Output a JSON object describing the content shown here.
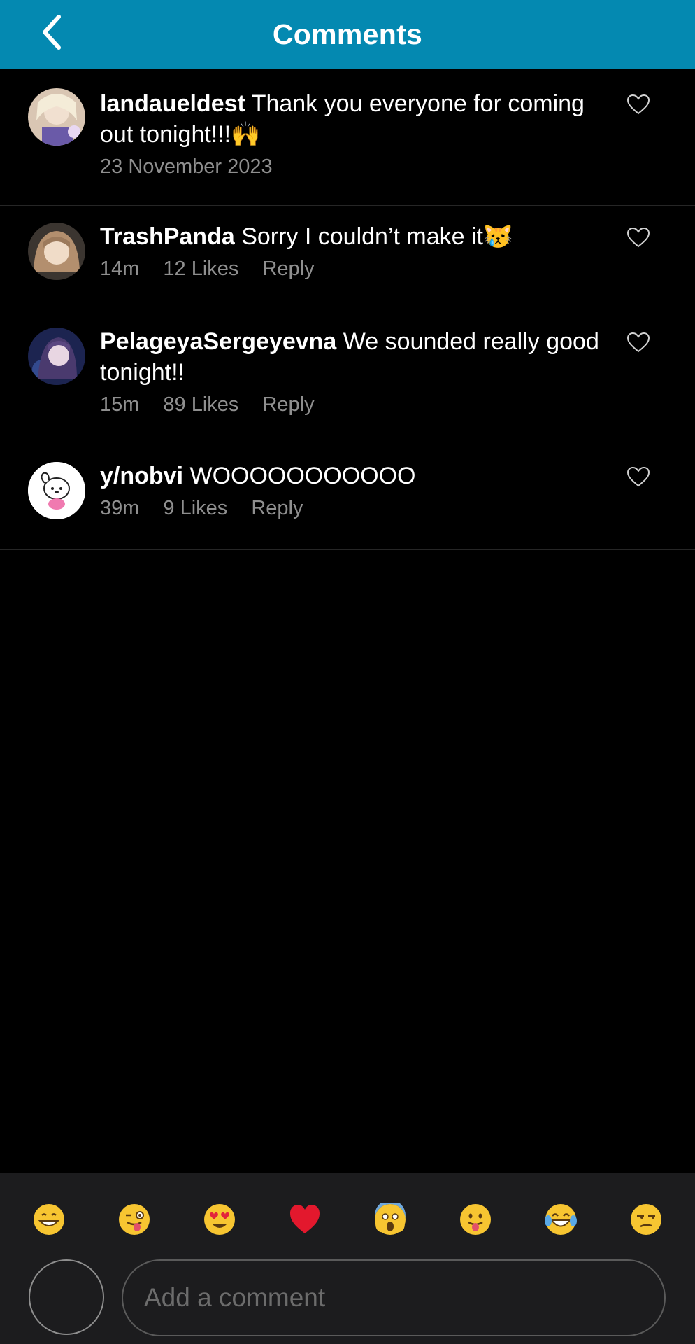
{
  "header": {
    "title": "Comments"
  },
  "comments": [
    {
      "username": "landaueldest",
      "text": "Thank you everyone for coming out tonight!!!🙌",
      "date": "23 November 2023"
    },
    {
      "username": "TrashPanda",
      "text": "Sorry I couldn’t make it😿",
      "time": "14m",
      "likes": "12 Likes",
      "reply": "Reply"
    },
    {
      "username": "PelageyaSergeyevna",
      "text": "We sounded really good tonight!!",
      "time": "15m",
      "likes": "89 Likes",
      "reply": "Reply"
    },
    {
      "username": "y/nobvi",
      "text": "WOOOOOOOOOOO",
      "time": "39m",
      "likes": "9 Likes",
      "reply": "Reply"
    }
  ],
  "emoji_bar": [
    "grin-icon",
    "wink-tongue-icon",
    "heart-eyes-icon",
    "red-heart-icon",
    "scream-icon",
    "tongue-icon",
    "tears-of-joy-icon",
    "unamused-icon"
  ],
  "composer": {
    "placeholder": "Add a comment"
  },
  "colors": {
    "header_bg": "#0489b1",
    "background": "#000000",
    "meta_text": "#8f8f8f",
    "emoji_bar_bg": "#1c1c1e"
  }
}
